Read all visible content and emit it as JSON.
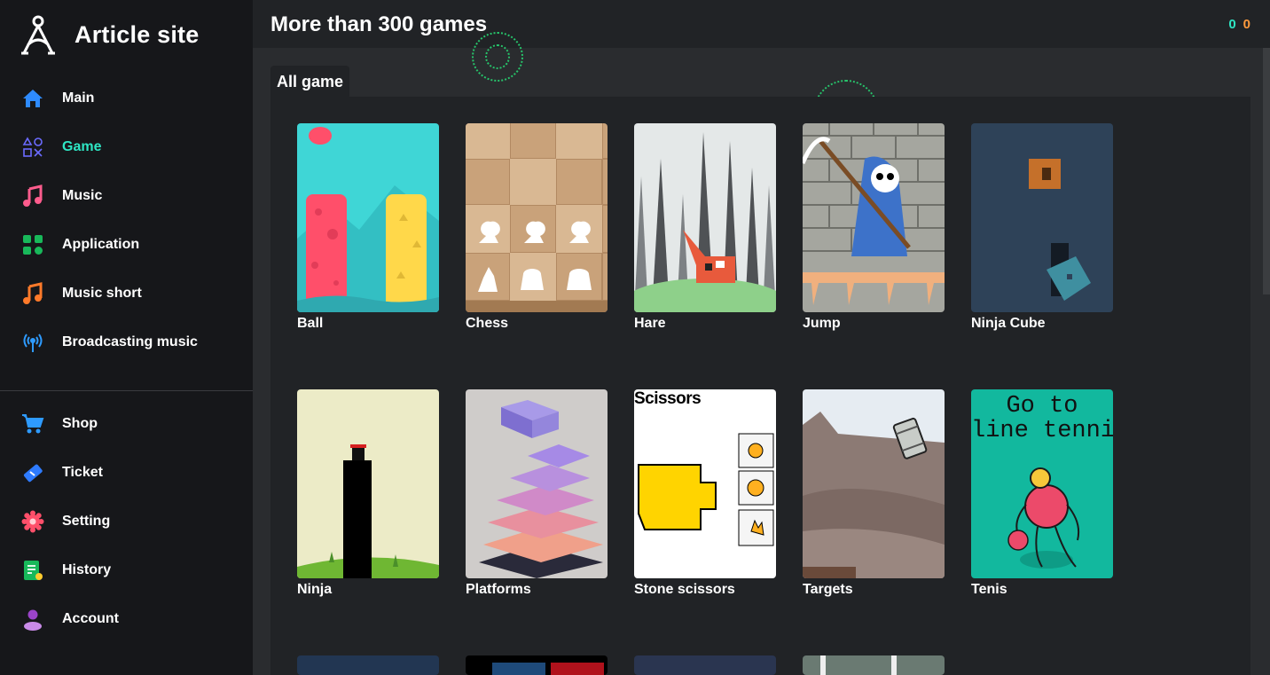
{
  "site": {
    "name": "Article site"
  },
  "nav": {
    "main": [
      {
        "label": "Main",
        "icon": "home-icon"
      },
      {
        "label": "Game",
        "icon": "gamepad-symbols-icon"
      },
      {
        "label": "Music",
        "icon": "music-note-icon"
      },
      {
        "label": "Application",
        "icon": "apps-grid-icon"
      },
      {
        "label": "Music short",
        "icon": "music-short-icon"
      },
      {
        "label": "Broadcasting music",
        "icon": "broadcast-icon"
      }
    ],
    "secondary": [
      {
        "label": "Shop",
        "icon": "cart-icon"
      },
      {
        "label": "Ticket",
        "icon": "ticket-icon"
      },
      {
        "label": "Setting",
        "icon": "gear-icon"
      },
      {
        "label": "History",
        "icon": "history-icon"
      },
      {
        "label": "Account",
        "icon": "account-icon"
      }
    ],
    "active": "Game"
  },
  "header": {
    "title": "More than 300 games",
    "score_a": "0",
    "score_b": "0"
  },
  "tabs": [
    {
      "label": "All game"
    }
  ],
  "games": [
    {
      "label": "Ball"
    },
    {
      "label": "Chess"
    },
    {
      "label": "Hare"
    },
    {
      "label": "Jump"
    },
    {
      "label": "Ninja Cube"
    },
    {
      "label": "Ninja"
    },
    {
      "label": "Platforms"
    },
    {
      "label": "Stone scissors"
    },
    {
      "label": "Targets"
    },
    {
      "label": "Tenis"
    }
  ],
  "thumb_text": {
    "scissors": "Scissors",
    "tennis_line1": "Go to",
    "tennis_line2": "line tennis"
  },
  "colors": {
    "accent": "#2ee6c4",
    "score_b": "#ff9a3c",
    "sidebar_bg": "#16171a",
    "panel_bg": "#212326"
  }
}
